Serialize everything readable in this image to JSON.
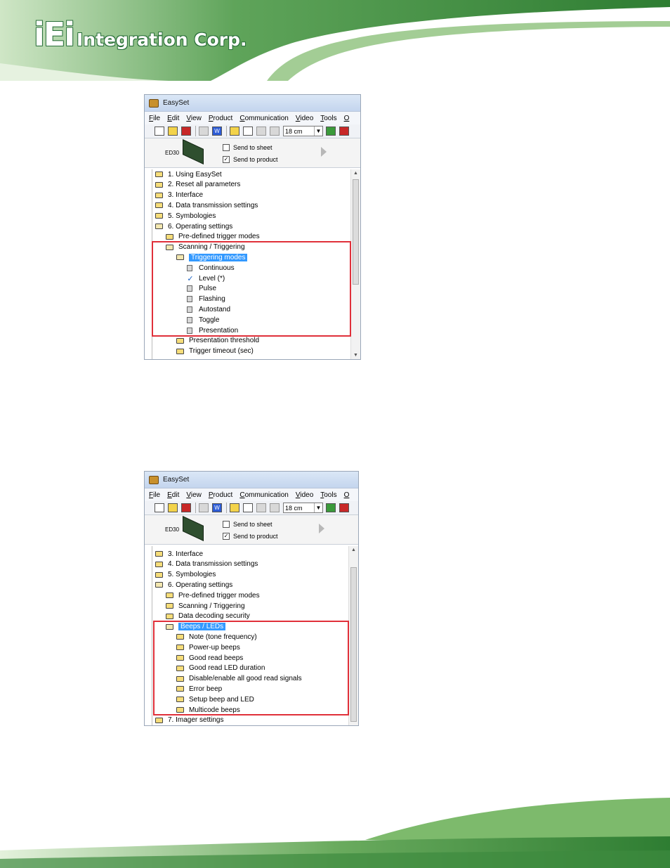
{
  "header": {
    "logo_iei": "iEi",
    "logo_rest": "Integration Corp."
  },
  "colors": {
    "accent_green": "#3d8a3e",
    "highlight_red": "#e0303a",
    "selection_blue": "#3399ff"
  },
  "window": {
    "title": "EasySet",
    "menu": [
      "File",
      "Edit",
      "View",
      "Product",
      "Communication",
      "Video",
      "Tools",
      "O"
    ],
    "distance": "18 cm",
    "device_label": "ED30",
    "send_to_sheet": "Send to sheet",
    "send_to_product": "Send to product"
  },
  "screenshot1": {
    "tree": [
      {
        "label": "1. Using EasySet",
        "icon": "folder",
        "level": 0
      },
      {
        "label": "2. Reset all parameters",
        "icon": "folder",
        "level": 0
      },
      {
        "label": "3. Interface",
        "icon": "folder",
        "level": 0
      },
      {
        "label": "4. Data transmission settings",
        "icon": "folder",
        "level": 0
      },
      {
        "label": "5. Symbologies",
        "icon": "folder",
        "level": 0
      },
      {
        "label": "6. Operating settings",
        "icon": "folder-open",
        "level": 0
      },
      {
        "label": "Pre-defined trigger modes",
        "icon": "folder",
        "level": 1
      },
      {
        "label": "Scanning / Triggering",
        "icon": "folder-open",
        "level": 1
      },
      {
        "label": "Triggering modes",
        "icon": "folder-open",
        "level": 2,
        "selected": true
      },
      {
        "label": "Continuous",
        "icon": "doc",
        "level": 3
      },
      {
        "label": "Level (*)",
        "icon": "check",
        "level": 3
      },
      {
        "label": "Pulse",
        "icon": "doc",
        "level": 3
      },
      {
        "label": "Flashing",
        "icon": "doc",
        "level": 3
      },
      {
        "label": "Autostand",
        "icon": "doc",
        "level": 3
      },
      {
        "label": "Toggle",
        "icon": "doc",
        "level": 3
      },
      {
        "label": "Presentation",
        "icon": "doc",
        "level": 3
      },
      {
        "label": "Presentation threshold",
        "icon": "folder",
        "level": 2
      },
      {
        "label": "Trigger timeout (sec)",
        "icon": "folder",
        "level": 2
      }
    ]
  },
  "screenshot2": {
    "tree": [
      {
        "label": "3. Interface",
        "icon": "folder",
        "level": 0
      },
      {
        "label": "4. Data transmission settings",
        "icon": "folder",
        "level": 0
      },
      {
        "label": "5. Symbologies",
        "icon": "folder",
        "level": 0
      },
      {
        "label": "6. Operating settings",
        "icon": "folder-open",
        "level": 0
      },
      {
        "label": "Pre-defined trigger modes",
        "icon": "folder",
        "level": 1
      },
      {
        "label": "Scanning / Triggering",
        "icon": "folder",
        "level": 1
      },
      {
        "label": "Data decoding security",
        "icon": "folder",
        "level": 1
      },
      {
        "label": "Beeps / LEDs",
        "icon": "folder-open",
        "level": 1,
        "selected": true
      },
      {
        "label": "Note (tone frequency)",
        "icon": "folder",
        "level": 2
      },
      {
        "label": "Power-up beeps",
        "icon": "folder",
        "level": 2
      },
      {
        "label": "Good read beeps",
        "icon": "folder",
        "level": 2
      },
      {
        "label": "Good read LED duration",
        "icon": "folder",
        "level": 2
      },
      {
        "label": "Disable/enable all good read signals",
        "icon": "folder",
        "level": 2
      },
      {
        "label": "Error beep",
        "icon": "folder",
        "level": 2
      },
      {
        "label": "Setup beep and LED",
        "icon": "folder",
        "level": 2
      },
      {
        "label": "Multicode beeps",
        "icon": "folder",
        "level": 2
      },
      {
        "label": "7. Imager settings",
        "icon": "folder",
        "level": 0
      }
    ]
  }
}
